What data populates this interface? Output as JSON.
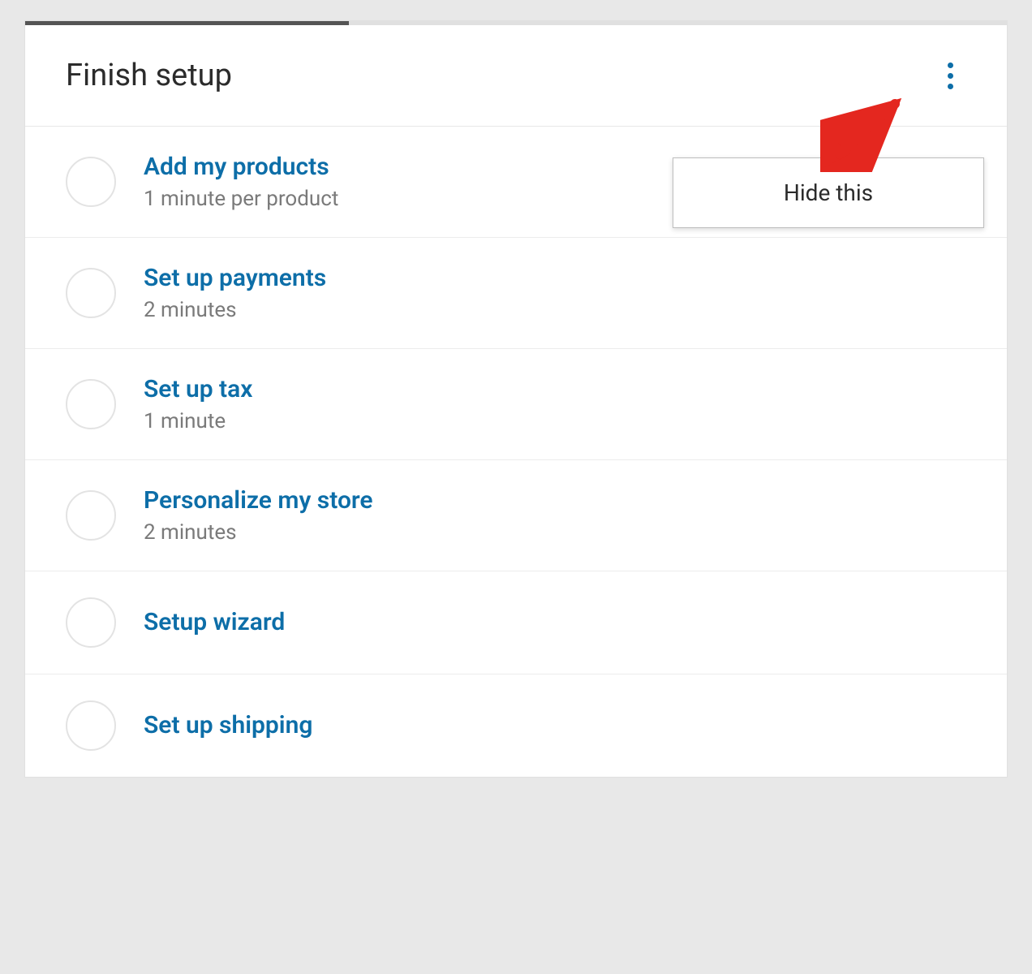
{
  "header": {
    "title": "Finish setup"
  },
  "popup": {
    "hide_label": "Hide this"
  },
  "tasks": [
    {
      "title": "Add my products",
      "subtitle": "1 minute per product"
    },
    {
      "title": "Set up payments",
      "subtitle": "2 minutes"
    },
    {
      "title": "Set up tax",
      "subtitle": "1 minute"
    },
    {
      "title": "Personalize my store",
      "subtitle": "2 minutes"
    },
    {
      "title": "Setup wizard",
      "subtitle": ""
    },
    {
      "title": "Set up shipping",
      "subtitle": ""
    }
  ],
  "colors": {
    "accent": "#0d6ea8",
    "progress": "#555555",
    "arrow": "#e4271f"
  }
}
